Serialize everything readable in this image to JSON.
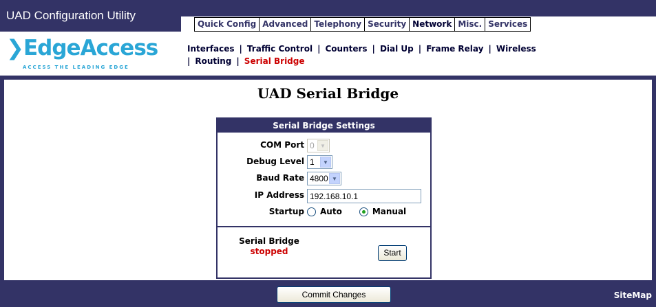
{
  "app": {
    "title": "UAD Configuration Utility"
  },
  "logo": {
    "name": "EdgeAccess",
    "tagline": "ACCESS THE LEADING EDGE"
  },
  "main_tabs": [
    {
      "label": "Quick Config",
      "active": false
    },
    {
      "label": "Advanced",
      "active": false
    },
    {
      "label": "Telephony",
      "active": false
    },
    {
      "label": "Security",
      "active": false
    },
    {
      "label": "Network",
      "active": true
    },
    {
      "label": "Misc.",
      "active": false
    },
    {
      "label": "Services",
      "active": false
    }
  ],
  "sub_nav": {
    "interfaces": "Interfaces",
    "traffic_control": "Traffic Control",
    "counters": "Counters",
    "dial_up": "Dial Up",
    "frame_relay": "Frame Relay",
    "wireless": "Wireless",
    "routing": "Routing",
    "serial_bridge": "Serial Bridge",
    "separator": "|"
  },
  "page": {
    "title": "UAD Serial Bridge"
  },
  "settings": {
    "header": "Serial Bridge Settings",
    "com_port": {
      "label": "COM Port",
      "value": "0",
      "disabled": true
    },
    "debug_level": {
      "label": "Debug Level",
      "value": "1"
    },
    "baud_rate": {
      "label": "Baud Rate",
      "value": "4800"
    },
    "ip_address": {
      "label": "IP Address",
      "value": "192.168.10.1"
    },
    "startup": {
      "label": "Startup",
      "options": [
        "Auto",
        "Manual"
      ],
      "selected": "Manual"
    }
  },
  "bridge": {
    "label": "Serial Bridge",
    "status": "stopped",
    "start_label": "Start"
  },
  "footer": {
    "commit_label": "Commit Changes",
    "sitemap_label": "SiteMap"
  },
  "colors": {
    "nav_bg": "#333366",
    "logo": "#2aa6d6",
    "active_link": "#cc0000",
    "radio_dot": "#21a121"
  }
}
